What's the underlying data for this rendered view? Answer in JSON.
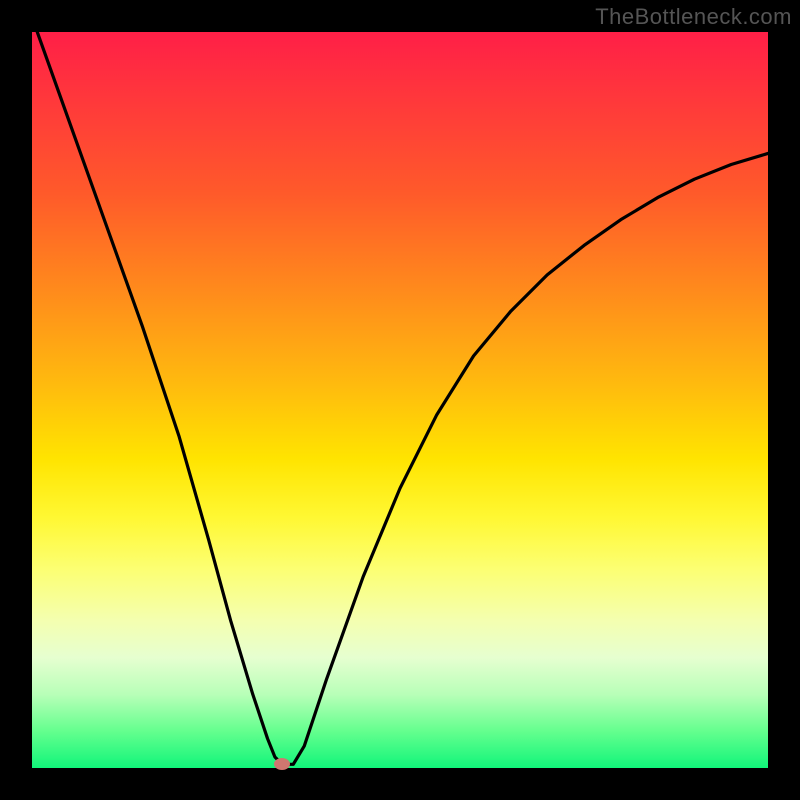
{
  "watermark": "TheBottleneck.com",
  "chart_data": {
    "type": "line",
    "title": "",
    "xlabel": "",
    "ylabel": "",
    "xlim": [
      0,
      100
    ],
    "ylim": [
      0,
      100
    ],
    "series": [
      {
        "name": "curve",
        "x": [
          0,
          5,
          10,
          15,
          20,
          24,
          27,
          30,
          32,
          33,
          34,
          35.5,
          37,
          40,
          45,
          50,
          55,
          60,
          65,
          70,
          75,
          80,
          85,
          90,
          95,
          100
        ],
        "values": [
          102,
          88,
          74,
          60,
          45,
          31,
          20,
          10,
          4,
          1.5,
          0.5,
          0.5,
          3,
          12,
          26,
          38,
          48,
          56,
          62,
          67,
          71,
          74.5,
          77.5,
          80,
          82,
          83.5
        ]
      }
    ],
    "marker": {
      "x": 34,
      "y": 0.5
    },
    "gradient_note": "background vertical gradient red→orange→yellow→green encodes score"
  }
}
